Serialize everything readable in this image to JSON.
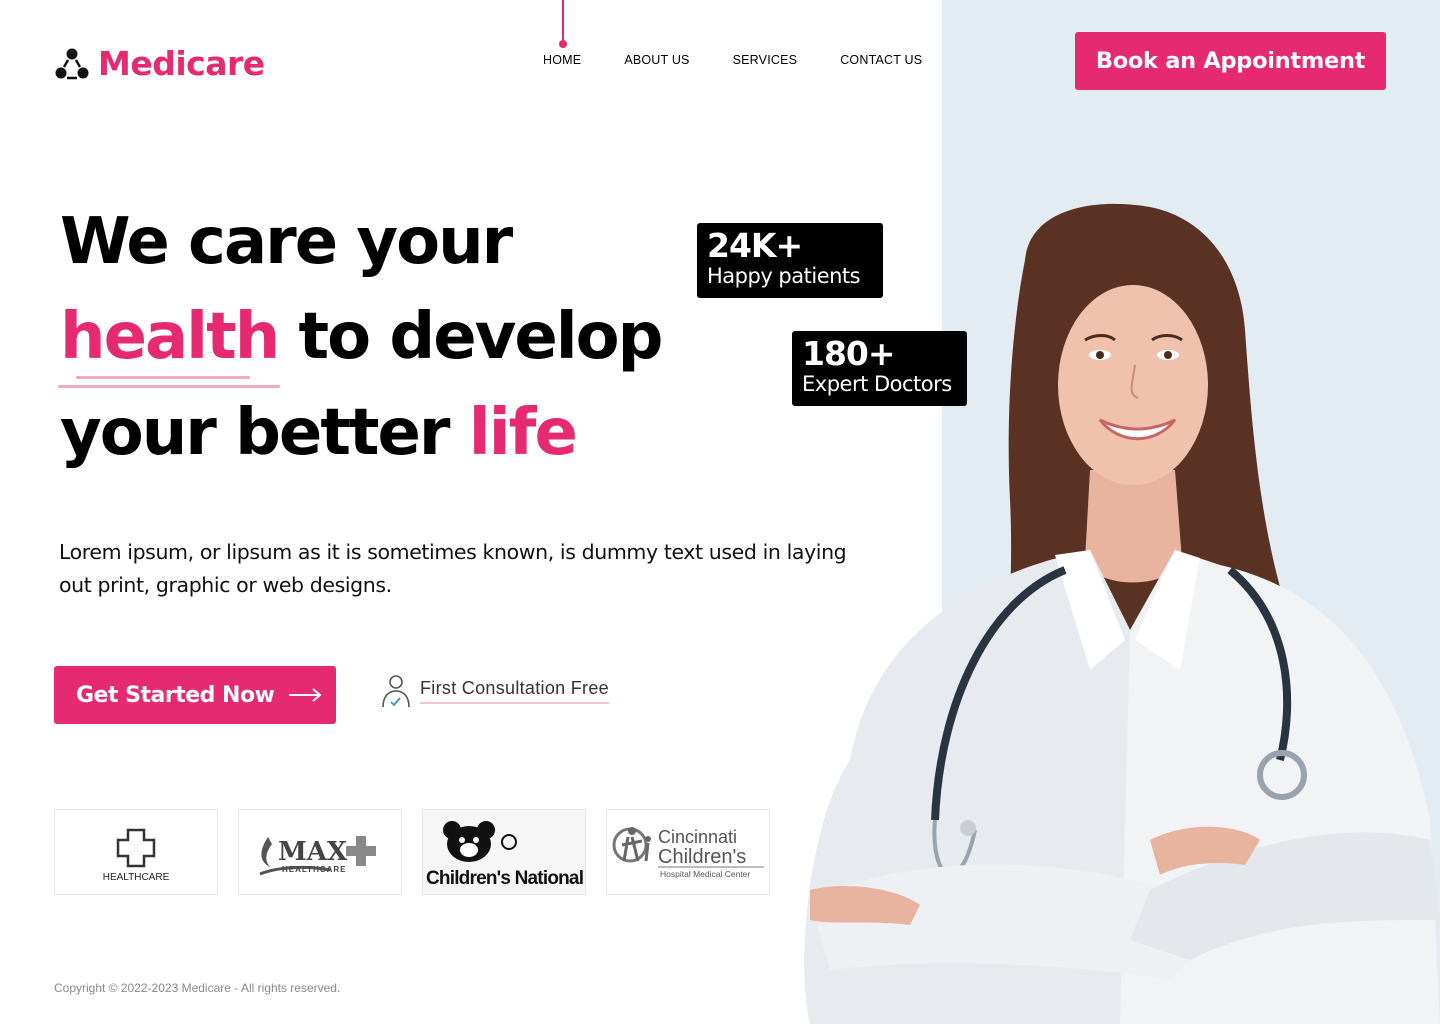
{
  "brand": {
    "name": "Medicare",
    "accent": "#e62a72",
    "logo_icon": "molecule-icon"
  },
  "nav": {
    "items": [
      {
        "label": "HOME",
        "active": true
      },
      {
        "label": "ABOUT US",
        "active": false
      },
      {
        "label": "SERVICES",
        "active": false
      },
      {
        "label": "CONTACT US",
        "active": false
      }
    ]
  },
  "header": {
    "book_label": "Book an Appointment"
  },
  "hero": {
    "line1": "We care your",
    "line2_highlight": "health",
    "line2_rest": " to develop",
    "line3_start": "your better ",
    "line3_highlight": "life",
    "description": "Lorem ipsum, or lipsum as it is sometimes known, is dummy text used in laying out print, graphic or web designs."
  },
  "stats": [
    {
      "value": "24K+",
      "label": "Happy patients"
    },
    {
      "value": "180+",
      "label": "Expert Doctors"
    }
  ],
  "cta": {
    "label": "Get Started Now",
    "icon": "arrow-right-icon"
  },
  "consult": {
    "label": "First Consultation Free",
    "icon": "doctor-check-icon"
  },
  "partners": [
    {
      "name": "HEALTHCARE",
      "icon": "medical-cross-icon"
    },
    {
      "name": "MAX",
      "sub": "HEALTHCARE",
      "icon": "max-cross-icon"
    },
    {
      "name": "Children's National",
      "icon": "teddy-bear-icon"
    },
    {
      "name": "Cincinnati",
      "name2": "Children's",
      "sub": "Hospital Medical Center",
      "icon": "family-icon"
    }
  ],
  "footer": {
    "copyright": "Copyright © 2022-2023 Medicare - All rights reserved."
  },
  "colors": {
    "panel_bg": "#e3ebf3",
    "underline": "#f3a9be"
  }
}
